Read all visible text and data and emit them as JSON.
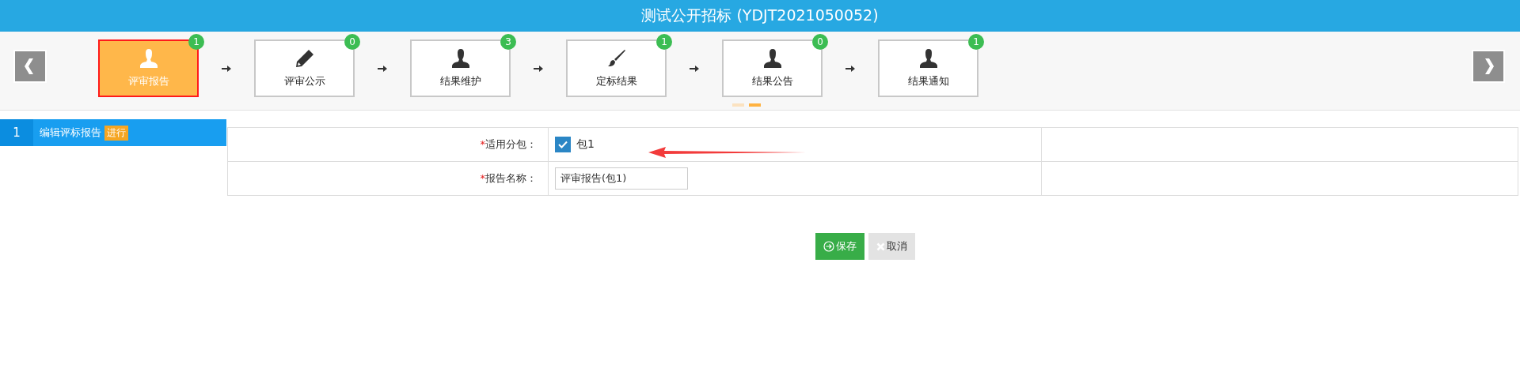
{
  "header": {
    "title": "测试公开招标 (YDJT2021050052)"
  },
  "steps": [
    {
      "label": "评审报告",
      "count": "1",
      "kind": "person",
      "selected": true
    },
    {
      "label": "评审公示",
      "count": "0",
      "kind": "pencil",
      "selected": false
    },
    {
      "label": "结果维护",
      "count": "3",
      "kind": "person",
      "selected": false
    },
    {
      "label": "定标结果",
      "count": "1",
      "kind": "brush",
      "selected": false
    },
    {
      "label": "结果公告",
      "count": "0",
      "kind": "person",
      "selected": false
    },
    {
      "label": "结果通知",
      "count": "1",
      "kind": "person",
      "selected": false
    }
  ],
  "pager_dots": [
    {
      "selected": false
    },
    {
      "selected": true
    }
  ],
  "sidebar": {
    "items": [
      {
        "number": "1",
        "label": "编辑评标报告",
        "badge": "进行",
        "selected": true
      }
    ]
  },
  "form": {
    "rows": [
      {
        "kind": "checkbox",
        "required_mark": "*",
        "label": "适用分包：",
        "option": "包1",
        "checked": true
      },
      {
        "kind": "text",
        "required_mark": "*",
        "label": "报告名称：",
        "value": "评审报告(包1)"
      }
    ]
  },
  "buttons": [
    {
      "kind": "save",
      "label": "保存"
    },
    {
      "kind": "cancel",
      "label": "取消"
    }
  ],
  "annotation": {
    "kind": "arrow"
  }
}
